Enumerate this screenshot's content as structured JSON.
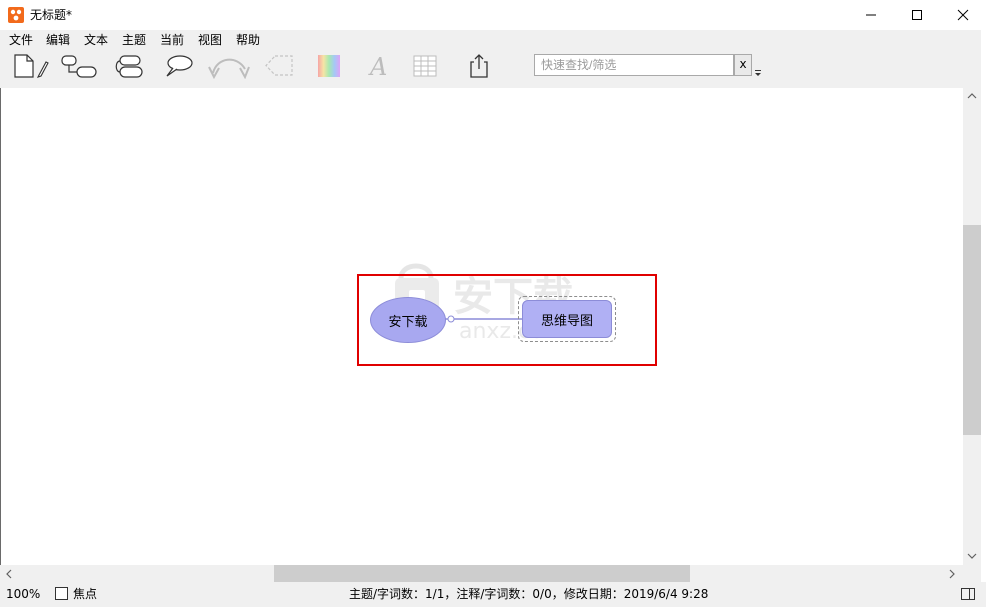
{
  "window": {
    "title": "无标题*"
  },
  "menu": {
    "items": [
      "文件",
      "编辑",
      "文本",
      "主题",
      "当前",
      "视图",
      "帮助"
    ]
  },
  "toolbar": {
    "tools": [
      {
        "icon": "new-document-icon"
      },
      {
        "icon": "add-subtopic-icon"
      },
      {
        "icon": "add-sibling-topic-icon"
      },
      {
        "icon": "callout-icon"
      },
      {
        "icon": "relationship-arrow-icon"
      },
      {
        "icon": "boundary-icon"
      },
      {
        "icon": "color-gradient-icon"
      },
      {
        "icon": "font-icon"
      },
      {
        "icon": "table-icon"
      },
      {
        "icon": "export-icon"
      }
    ],
    "search": {
      "placeholder": "快速查找/筛选",
      "clear_label": "x"
    }
  },
  "mindmap": {
    "root": {
      "text": "安下载"
    },
    "child": {
      "text": "思维导图"
    },
    "watermark_text": "安下载",
    "watermark_sub": "anxz.com",
    "colors": {
      "node_fill": "#a8a8f0",
      "highlight": "#e00000"
    }
  },
  "status": {
    "zoom": "100%",
    "focus_label": "焦点",
    "info": "主题/字词数：1/1，注释/字词数：0/0，修改日期：2019/6/4 9:28"
  }
}
